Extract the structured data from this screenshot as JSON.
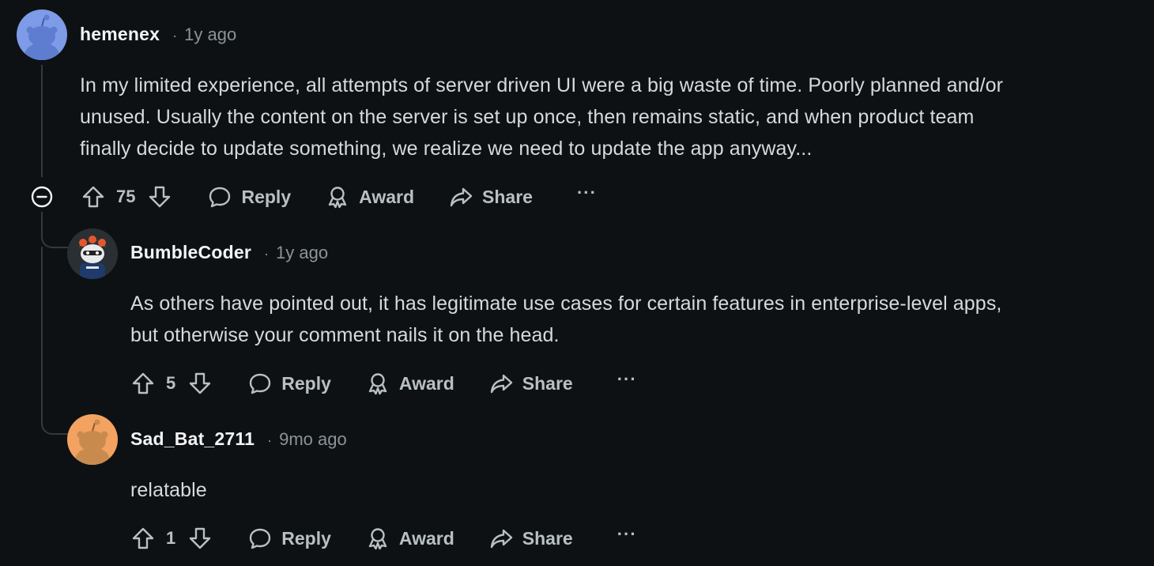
{
  "comments": [
    {
      "username": "hemenex",
      "timestamp": "1y ago",
      "body_lines": [
        "In my limited experience, all attempts of server driven UI were a big waste of time. Poorly planned and/or",
        "unused. Usually the content on the server is set up once, then remains static, and when product team",
        "finally decide to update something, we realize we need to update the app anyway..."
      ],
      "score": "75",
      "avatar_color": "#7e9be8"
    },
    {
      "username": "BumbleCoder",
      "timestamp": "1y ago",
      "body_lines": [
        "As others have pointed out, it has legitimate use cases for certain features in enterprise-level apps,",
        "but otherwise your comment nails it on the head."
      ],
      "score": "5",
      "avatar_color": "#2a2f33"
    },
    {
      "username": "Sad_Bat_2711",
      "timestamp": "9mo ago",
      "body_lines": [
        "relatable"
      ],
      "score": "1",
      "avatar_color": "#f4a261"
    }
  ],
  "actions": {
    "reply": "Reply",
    "award": "Award",
    "share": "Share",
    "more": "···"
  },
  "separator": "·",
  "icons": {
    "upvote": "upvote-arrow-icon",
    "downvote": "downvote-arrow-icon",
    "reply": "speech-bubble-icon",
    "award": "award-ribbon-icon",
    "share": "share-arrow-icon",
    "collapse": "collapse-minus-icon"
  },
  "colors": {
    "background": "#0e1113",
    "text": "#d7dadc",
    "muted": "#8a9499",
    "action": "#b8c0c4"
  }
}
